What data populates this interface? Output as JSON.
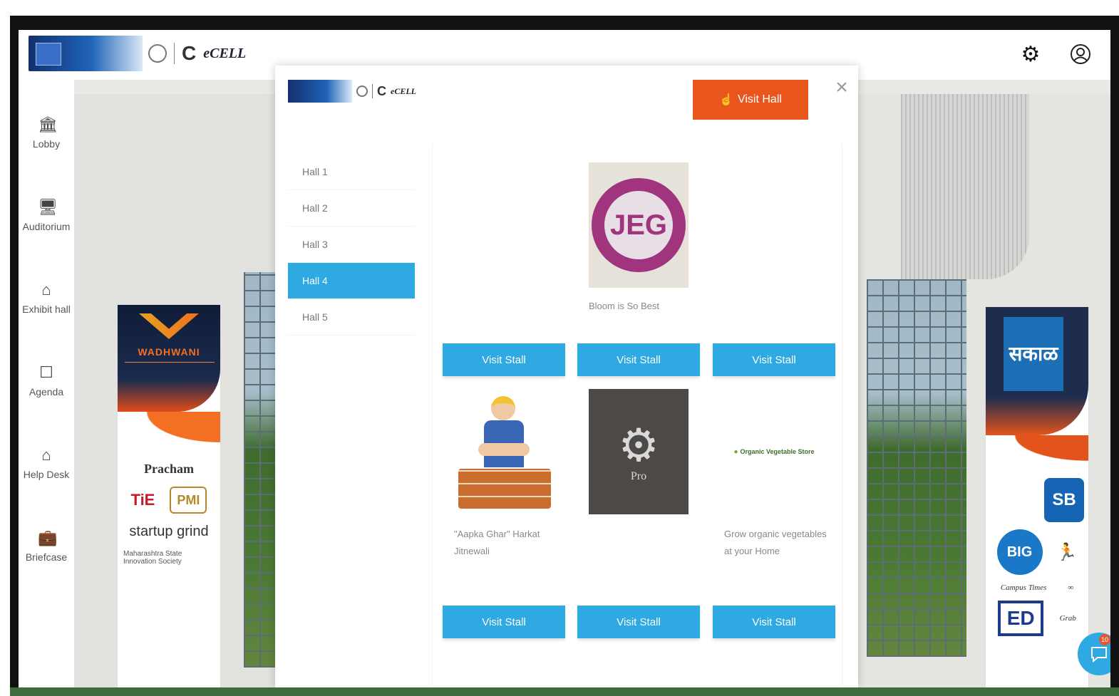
{
  "header": {
    "brand_mark": "C",
    "brand_name": "eCELL",
    "settings_icon": "gear-icon",
    "profile_icon": "user-circle-icon"
  },
  "sidebar": {
    "items": [
      {
        "label": "Lobby",
        "icon": "lobby-icon"
      },
      {
        "label": "Auditorium",
        "icon": "auditorium-icon"
      },
      {
        "label": "Exhibit hall",
        "icon": "exhibit-hall-icon"
      },
      {
        "label": "Agenda",
        "icon": "agenda-icon"
      },
      {
        "label": "Help Desk",
        "icon": "help-desk-icon"
      },
      {
        "label": "Briefcase",
        "icon": "briefcase-icon"
      }
    ]
  },
  "background": {
    "left_banner": {
      "title": "WADHWANI",
      "logos": [
        "Pracham",
        "TiE",
        "PMI",
        "startup grind",
        "Maharashtra State Innovation Society"
      ]
    },
    "right_banner": {
      "title": "सकाळ",
      "logos": [
        "SB",
        "BIG",
        "Campus Times",
        "ED"
      ],
      "trailing_text": "Grab"
    }
  },
  "modal": {
    "visit_hall_label": "Visit Hall",
    "close_icon": "close-icon",
    "halls": [
      {
        "label": "Hall 1",
        "active": false
      },
      {
        "label": "Hall 2",
        "active": false
      },
      {
        "label": "Hall 3",
        "active": false
      },
      {
        "label": "Hall 4",
        "active": true
      },
      {
        "label": "Hall 5",
        "active": false
      }
    ],
    "stalls": [
      {
        "image": "",
        "description": "",
        "button": "Visit Stall"
      },
      {
        "image": "JEG",
        "description": "Bloom is So Best",
        "button": "Visit Stall"
      },
      {
        "image": "",
        "description": "",
        "button": "Visit Stall"
      },
      {
        "image": "builder",
        "description": "\"Aapka Ghar\" Harkat Jitnewali",
        "button": "Visit Stall"
      },
      {
        "image": "gear",
        "image_text": "Pro",
        "description": "",
        "button": "Visit Stall"
      },
      {
        "image": "organic",
        "image_text": "Organic Vegetable Store",
        "description": "Grow organic vegetables at your Home",
        "button": "Visit Stall"
      }
    ]
  },
  "chat": {
    "icon": "chat-icon",
    "badge": "10"
  },
  "colors": {
    "accent_blue": "#2ea9e1",
    "accent_orange": "#e8561e"
  }
}
